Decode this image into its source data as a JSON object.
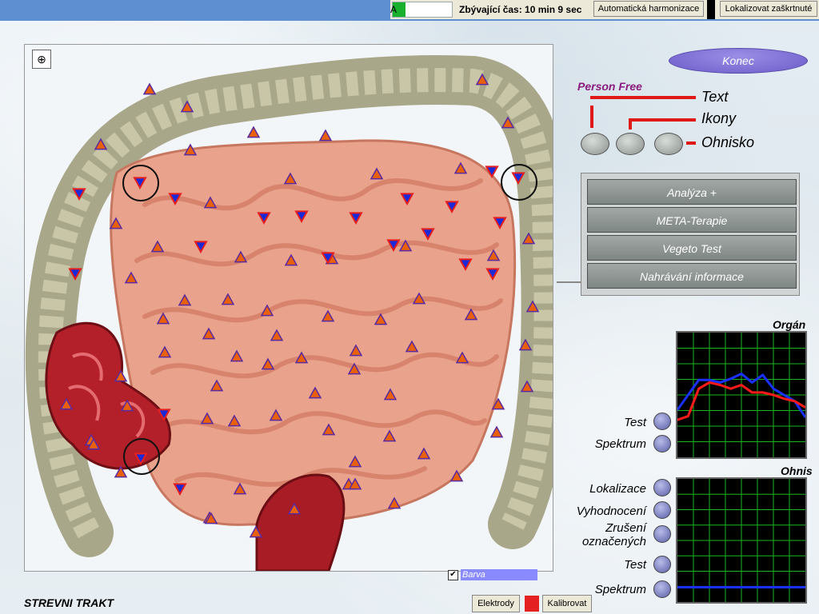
{
  "header": {
    "progress_label": "A",
    "progress_fraction": 0.22,
    "remaining_time": "Zbývající čas: 10 min 9 sec",
    "auto_harmonize_label": "Automatická harmonizace",
    "localize_checked_label": "Lokalizovat zaškrtnuté"
  },
  "image_panel": {
    "title": "STREVNI TRAKT",
    "color_toggle_label": "Barva",
    "color_toggle_checked": true,
    "zoom_icon": "magnifier-plus-icon"
  },
  "right_panel": {
    "exit_label": "Konec",
    "person_label": "Person Free",
    "legend": {
      "text": "Text",
      "icons": "Ikony",
      "focus": "Ohnisko"
    },
    "menu": [
      "Analýza +",
      "META-Terapie",
      "Vegeto Test",
      "Nahrávání informace"
    ],
    "organ_chart_label": "Orgán",
    "focus_chart_label": "Ohnis",
    "organ_controls": [
      "Test",
      "Spektrum"
    ],
    "focus_controls": [
      "Lokalizace",
      "Vyhodnocení",
      "Zrušení označených",
      "Test",
      "Spektrum"
    ]
  },
  "bottom": {
    "electrodes_label": "Elektrody",
    "calibrate_label": "Kalibrovat"
  },
  "colors": {
    "marker_up": "#e8600c",
    "marker_down": "#1a2ad8",
    "legend_line": "#e01818",
    "chart_grid": "#19b81e",
    "series_blue": "#1a30ff",
    "series_red": "#ff1a1a"
  },
  "chart_data": [
    {
      "type": "line",
      "title": "Orgán",
      "x": [
        0,
        1,
        2,
        3,
        4,
        5,
        6,
        7,
        8,
        9,
        10,
        11,
        12
      ],
      "series": [
        {
          "values": [
            0.38,
            0.5,
            0.62,
            0.62,
            0.6,
            0.63,
            0.67,
            0.6,
            0.66,
            0.55,
            0.5,
            0.45,
            0.32
          ]
        },
        {
          "values": [
            0.3,
            0.33,
            0.55,
            0.6,
            0.58,
            0.55,
            0.58,
            0.52,
            0.52,
            0.5,
            0.47,
            0.45,
            0.4
          ]
        }
      ],
      "ylim": [
        0,
        1
      ],
      "grid": true
    },
    {
      "type": "line",
      "title": "Ohnis",
      "x": [
        0,
        1
      ],
      "series": [
        {
          "values": [
            0.12,
            0.12
          ]
        }
      ],
      "ylim": [
        0,
        1
      ],
      "grid": true
    }
  ],
  "markers": {
    "up_count": 58,
    "down_count": 20,
    "circled_count": 3
  }
}
